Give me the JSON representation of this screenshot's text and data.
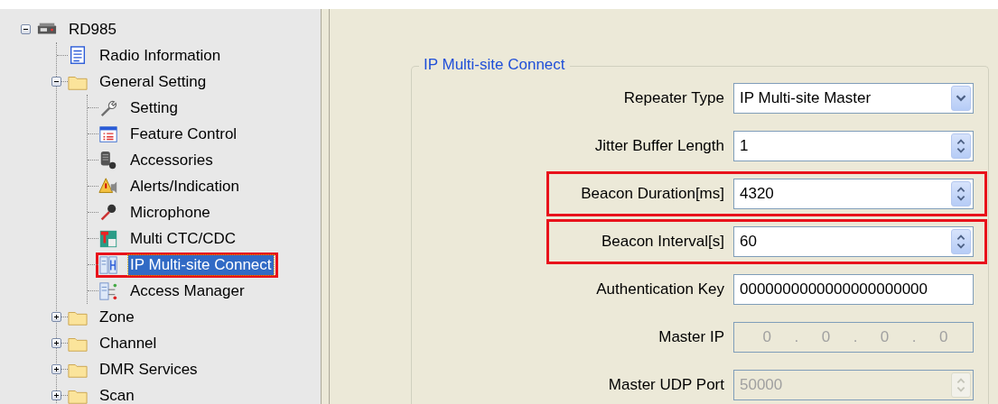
{
  "tree": {
    "label": "RD985",
    "kind": "device",
    "expanded": true,
    "selected": false,
    "highlighted": false,
    "children": [
      {
        "label": "Radio Information",
        "kind": "document",
        "selected": false,
        "highlighted": false
      },
      {
        "label": "General Setting",
        "kind": "folder",
        "expanded": true,
        "selected": false,
        "highlighted": false,
        "children": [
          {
            "label": "Setting",
            "kind": "wrench",
            "selected": false,
            "highlighted": false
          },
          {
            "label": "Feature Control",
            "kind": "list-window",
            "selected": false,
            "highlighted": false
          },
          {
            "label": "Accessories",
            "kind": "speaker-mic",
            "selected": false,
            "highlighted": false
          },
          {
            "label": "Alerts/Indication",
            "kind": "warning",
            "selected": false,
            "highlighted": false
          },
          {
            "label": "Microphone",
            "kind": "microphone",
            "selected": false,
            "highlighted": false
          },
          {
            "label": "Multi CTC/CDC",
            "kind": "tone-badge",
            "selected": false,
            "highlighted": false
          },
          {
            "label": "IP Multi-site Connect",
            "kind": "network",
            "selected": true,
            "highlighted": true
          },
          {
            "label": "Access Manager",
            "kind": "server",
            "selected": false,
            "highlighted": false
          }
        ]
      },
      {
        "label": "Zone",
        "kind": "folder",
        "expanded": false,
        "selected": false,
        "highlighted": false
      },
      {
        "label": "Channel",
        "kind": "folder",
        "expanded": false,
        "selected": false,
        "highlighted": false
      },
      {
        "label": "DMR Services",
        "kind": "folder",
        "expanded": false,
        "selected": false,
        "highlighted": false
      },
      {
        "label": "Scan",
        "kind": "folder",
        "expanded": false,
        "selected": false,
        "highlighted": false
      }
    ]
  },
  "form": {
    "title": "IP Multi-site Connect",
    "fields": [
      {
        "label": "Repeater Type",
        "kind": "combo",
        "value": "IP Multi-site Master",
        "disabled": false,
        "highlighted": false
      },
      {
        "label": "Jitter Buffer Length",
        "kind": "spin",
        "value": "1",
        "disabled": false,
        "highlighted": false
      },
      {
        "label": "Beacon Duration[ms]",
        "kind": "spin",
        "value": "4320",
        "disabled": false,
        "highlighted": true
      },
      {
        "label": "Beacon Interval[s]",
        "kind": "spin",
        "value": "60",
        "disabled": false,
        "highlighted": true
      },
      {
        "label": "Authentication Key",
        "kind": "text",
        "value": "0000000000000000000000",
        "disabled": false,
        "highlighted": false
      },
      {
        "label": "Master IP",
        "kind": "ip",
        "octets": [
          "0",
          "0",
          "0",
          "0"
        ],
        "separator": ".",
        "disabled": true,
        "highlighted": false
      },
      {
        "label": "Master UDP Port",
        "kind": "spin",
        "value": "50000",
        "disabled": true,
        "highlighted": false
      }
    ]
  }
}
